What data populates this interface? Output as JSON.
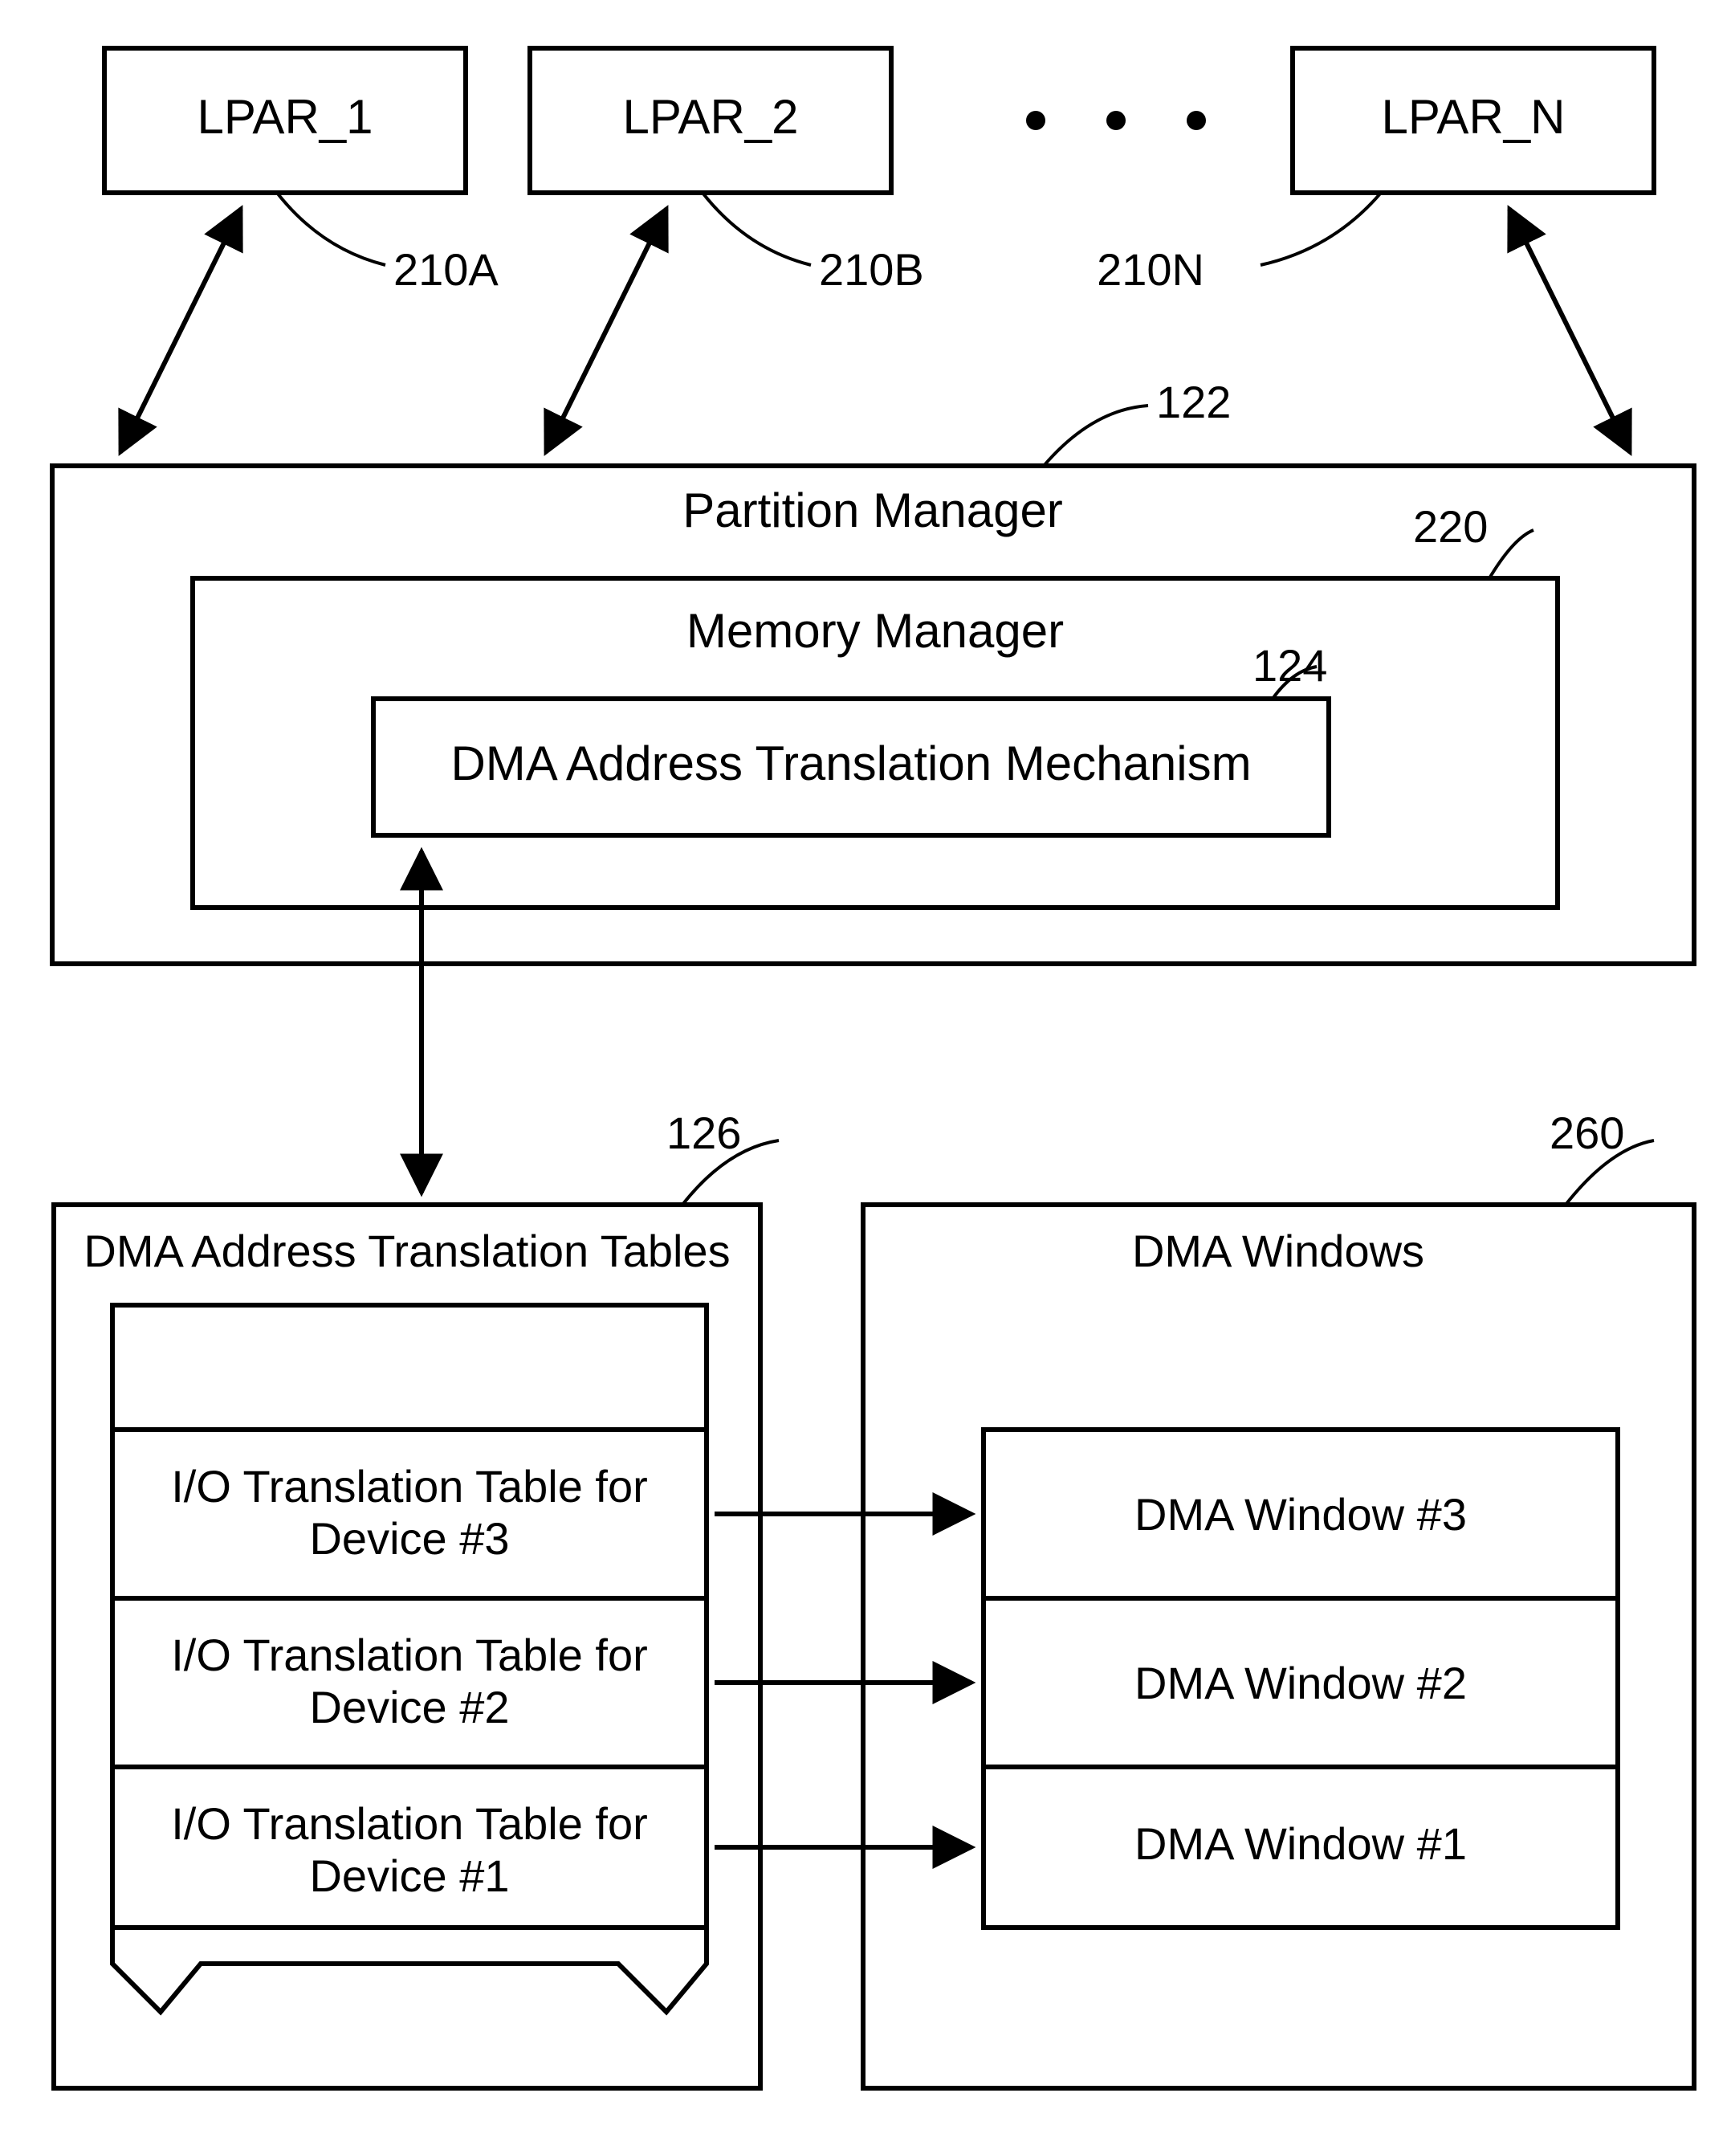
{
  "lpar": {
    "a": {
      "label": "LPAR_1",
      "ref": "210A"
    },
    "b": {
      "label": "LPAR_2",
      "ref": "210B"
    },
    "n": {
      "label": "LPAR_N",
      "ref": "210N"
    }
  },
  "pm": {
    "title": "Partition Manager",
    "ref": "122",
    "mm": {
      "title": "Memory Manager",
      "ref": "220",
      "dma": {
        "title": "DMA Address Translation Mechanism",
        "ref": "124"
      }
    }
  },
  "tables": {
    "title": "DMA Address Translation Tables",
    "ref": "126",
    "rows": [
      "I/O Translation Table for Device #3",
      "I/O Translation Table for Device #2",
      "I/O Translation Table for Device #1"
    ]
  },
  "windows": {
    "title": "DMA Windows",
    "ref": "260",
    "rows": [
      "DMA Window #3",
      "DMA Window #2",
      "DMA Window #1"
    ]
  }
}
